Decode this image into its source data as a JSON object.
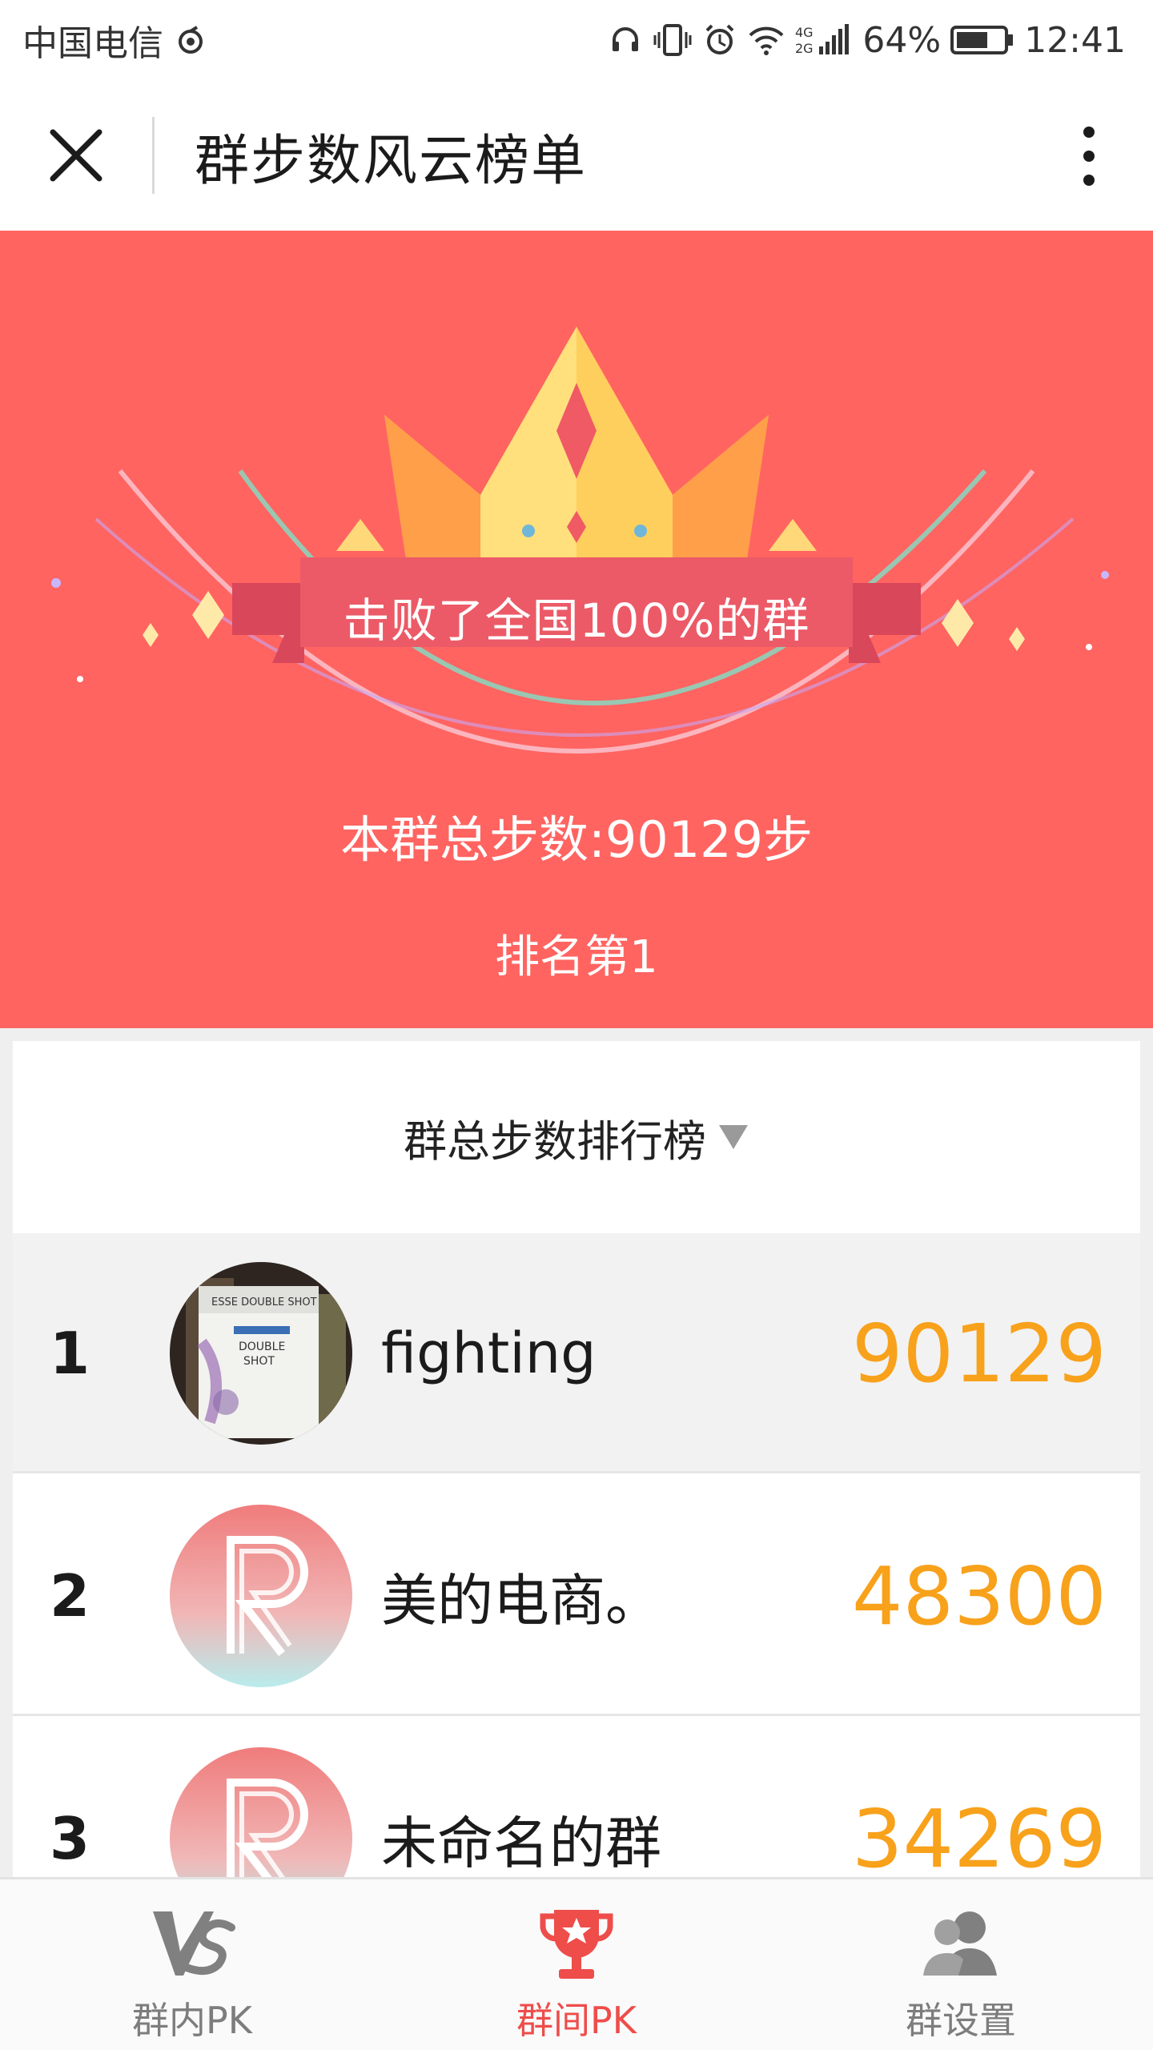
{
  "status_bar": {
    "carrier": "中国电信",
    "network": "4G 2G",
    "battery": "64%",
    "time": "12:41"
  },
  "title_bar": {
    "title": "群步数风云榜单"
  },
  "hero": {
    "banner_text": "击败了全国100%的群",
    "total_steps": "本群总步数:90129步",
    "rank": "排名第1"
  },
  "ranking": {
    "header": "群总步数排行榜",
    "rows": [
      {
        "rank": "1",
        "name": "fighting",
        "steps": "90129"
      },
      {
        "rank": "2",
        "name": "美的电商。",
        "steps": "48300"
      },
      {
        "rank": "3",
        "name": "未命名的群",
        "steps": "34269"
      }
    ]
  },
  "bottom_nav": {
    "items": [
      {
        "label": "群内PK",
        "icon": "vs-icon"
      },
      {
        "label": "群间PK",
        "icon": "trophy-icon"
      },
      {
        "label": "群设置",
        "icon": "users-icon"
      }
    ]
  },
  "colors": {
    "hero_bg": "#ff6461",
    "steps_orange": "#f8a11b",
    "active_nav": "#ee4d4a"
  }
}
